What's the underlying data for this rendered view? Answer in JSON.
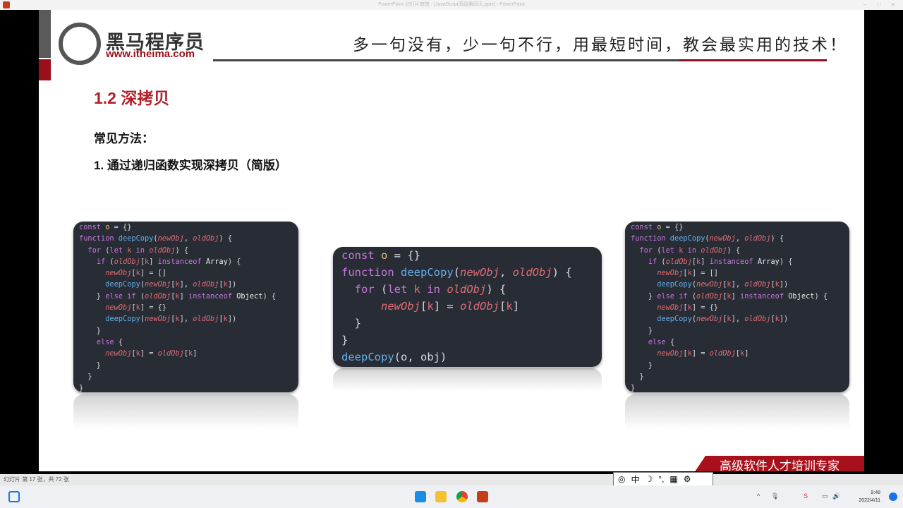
{
  "window": {
    "title": "PowerPoint 幻灯片放映 - [JavaScript高级第四天.pptx] - PowerPoint"
  },
  "slide": {
    "logo_cn": "黑马程序员",
    "logo_url": "www.itheima.com",
    "slogan": "多一句没有，少一句不行，用最短时间，教会最实用的技术！",
    "heading": "1.2 深拷贝",
    "subheading": "常见方法：",
    "method": "1. 通过递归函数实现深拷贝（简版）",
    "badge": "高级软件人才培训专家",
    "code_full": [
      [
        [
          "kw",
          "const "
        ],
        [
          "va",
          "o"
        ],
        [
          "pl",
          " = {}"
        ]
      ],
      [
        [
          "kw",
          "function "
        ],
        [
          "fn",
          "deepCopy"
        ],
        [
          "pl",
          "("
        ],
        [
          "pa",
          "newObj"
        ],
        [
          "pl",
          ", "
        ],
        [
          "pa",
          "oldObj"
        ],
        [
          "pl",
          ") {"
        ]
      ],
      [
        [
          "pl",
          "  "
        ],
        [
          "kw",
          "for "
        ],
        [
          "pl",
          "("
        ],
        [
          "kw",
          "let "
        ],
        [
          "k",
          "k "
        ],
        [
          "kw",
          "in "
        ],
        [
          "pa",
          "oldObj"
        ],
        [
          "pl",
          ") {"
        ]
      ],
      [
        [
          "pl",
          "    "
        ],
        [
          "kw",
          "if "
        ],
        [
          "pl",
          "("
        ],
        [
          "pa",
          "oldObj"
        ],
        [
          "pl",
          "["
        ],
        [
          "k",
          "k"
        ],
        [
          "pl",
          "] "
        ],
        [
          "kw",
          "instanceof "
        ],
        [
          "ty",
          "Array"
        ],
        [
          "pl",
          ") {"
        ]
      ],
      [
        [
          "pl",
          "      "
        ],
        [
          "pa",
          "newObj"
        ],
        [
          "pl",
          "["
        ],
        [
          "k",
          "k"
        ],
        [
          "pl",
          "] = []"
        ]
      ],
      [
        [
          "pl",
          "      "
        ],
        [
          "fn",
          "deepCopy"
        ],
        [
          "pl",
          "("
        ],
        [
          "pa",
          "newObj"
        ],
        [
          "pl",
          "["
        ],
        [
          "k",
          "k"
        ],
        [
          "pl",
          "], "
        ],
        [
          "pa",
          "oldObj"
        ],
        [
          "pl",
          "["
        ],
        [
          "k",
          "k"
        ],
        [
          "pl",
          "])"
        ]
      ],
      [
        [
          "pl",
          "    } "
        ],
        [
          "kw",
          "else if "
        ],
        [
          "pl",
          "("
        ],
        [
          "pa",
          "oldObj"
        ],
        [
          "pl",
          "["
        ],
        [
          "k",
          "k"
        ],
        [
          "pl",
          "] "
        ],
        [
          "kw",
          "instanceof "
        ],
        [
          "ty",
          "Object"
        ],
        [
          "pl",
          ") {"
        ]
      ],
      [
        [
          "pl",
          "      "
        ],
        [
          "pa",
          "newObj"
        ],
        [
          "pl",
          "["
        ],
        [
          "k",
          "k"
        ],
        [
          "pl",
          "] = {}"
        ]
      ],
      [
        [
          "pl",
          "      "
        ],
        [
          "fn",
          "deepCopy"
        ],
        [
          "pl",
          "("
        ],
        [
          "pa",
          "newObj"
        ],
        [
          "pl",
          "["
        ],
        [
          "k",
          "k"
        ],
        [
          "pl",
          "], "
        ],
        [
          "pa",
          "oldObj"
        ],
        [
          "pl",
          "["
        ],
        [
          "k",
          "k"
        ],
        [
          "pl",
          "])"
        ]
      ],
      [
        [
          "pl",
          "    }"
        ]
      ],
      [
        [
          "pl",
          "    "
        ],
        [
          "kw",
          "else "
        ],
        [
          "pl",
          "{"
        ]
      ],
      [
        [
          "pl",
          "      "
        ],
        [
          "pa",
          "newObj"
        ],
        [
          "pl",
          "["
        ],
        [
          "k",
          "k"
        ],
        [
          "pl",
          "] = "
        ],
        [
          "pa",
          "oldObj"
        ],
        [
          "pl",
          "["
        ],
        [
          "k",
          "k"
        ],
        [
          "pl",
          "]"
        ]
      ],
      [
        [
          "pl",
          "    }"
        ]
      ],
      [
        [
          "pl",
          "  }"
        ]
      ],
      [
        [
          "pl",
          "}"
        ]
      ]
    ],
    "code_simple": [
      [
        [
          "kw",
          "const "
        ],
        [
          "va",
          "o"
        ],
        [
          "pl",
          " = {}"
        ]
      ],
      [
        [
          "kw",
          "function "
        ],
        [
          "fn",
          "deepCopy"
        ],
        [
          "pl",
          "("
        ],
        [
          "pa",
          "newObj"
        ],
        [
          "pl",
          ", "
        ],
        [
          "pa",
          "oldObj"
        ],
        [
          "pl",
          ") {"
        ]
      ],
      [
        [
          "pl",
          "  "
        ],
        [
          "kw",
          "for "
        ],
        [
          "pl",
          "("
        ],
        [
          "kw",
          "let "
        ],
        [
          "k",
          "k "
        ],
        [
          "kw",
          "in "
        ],
        [
          "pa",
          "oldObj"
        ],
        [
          "pl",
          ") {"
        ]
      ],
      [
        [
          "pl",
          "      "
        ],
        [
          "pa",
          "newObj"
        ],
        [
          "pl",
          "["
        ],
        [
          "k",
          "k"
        ],
        [
          "pl",
          "] = "
        ],
        [
          "pa",
          "oldObj"
        ],
        [
          "pl",
          "["
        ],
        [
          "k",
          "k"
        ],
        [
          "pl",
          "]"
        ]
      ],
      [
        [
          "pl",
          "  }"
        ]
      ],
      [
        [
          "pl",
          "}"
        ]
      ],
      [
        [
          "fn",
          "deepCopy"
        ],
        [
          "pl",
          "(o, obj)"
        ]
      ]
    ]
  },
  "status": {
    "slide_counter": "幻灯片 第 17 张，共 72 张"
  },
  "ime": {
    "mode": "中"
  },
  "taskbar": {
    "time": "9:48",
    "date": "2022/4/11"
  }
}
